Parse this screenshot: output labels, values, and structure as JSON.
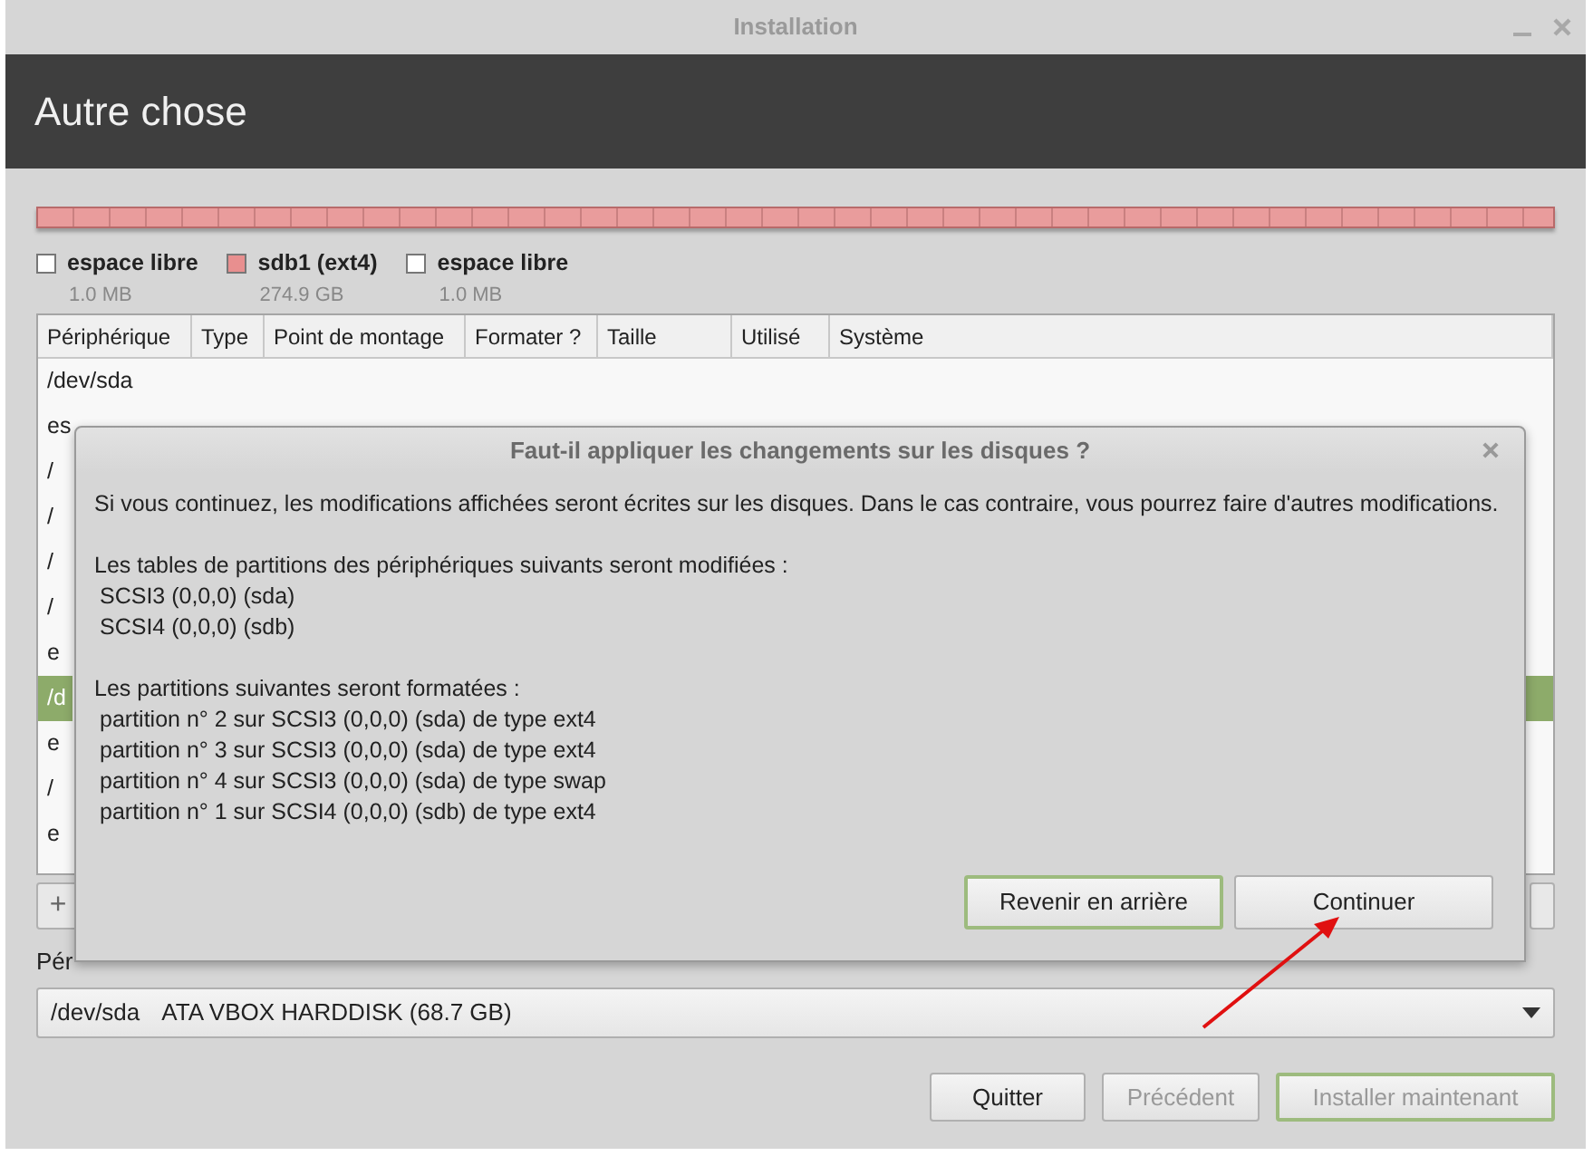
{
  "window": {
    "title": "Installation"
  },
  "header": {
    "title": "Autre chose"
  },
  "legend": [
    {
      "label": "espace libre",
      "size": "1.0 MB",
      "color": "#ffffff"
    },
    {
      "label": "sdb1 (ext4)",
      "size": "274.9 GB",
      "color": "#e88f8f"
    },
    {
      "label": "espace libre",
      "size": "1.0 MB",
      "color": "#ffffff"
    }
  ],
  "table": {
    "columns": [
      "Périphérique",
      "Type",
      "Point de montage",
      "Formater ?",
      "Taille",
      "Utilisé",
      "Système"
    ],
    "rows": [
      {
        "device": "/dev/sda",
        "selected": false
      },
      {
        "device": "es",
        "selected": false
      },
      {
        "device": "/",
        "selected": false
      },
      {
        "device": "/",
        "selected": false
      },
      {
        "device": "/",
        "selected": false
      },
      {
        "device": "/",
        "selected": false
      },
      {
        "device": "e",
        "selected": false
      },
      {
        "device": "/d",
        "selected": true
      },
      {
        "device": "e",
        "selected": false
      },
      {
        "device": "/",
        "selected": false
      },
      {
        "device": "e",
        "selected": false
      }
    ]
  },
  "toolbar": {
    "add_button": "+"
  },
  "boot_device": {
    "label": "Pér",
    "device": "/dev/sda",
    "description": "ATA VBOX HARDDISK (68.7 GB)"
  },
  "buttons": [
    {
      "label": "Quitter",
      "disabled": false,
      "default": false
    },
    {
      "label": "Précédent",
      "disabled": true,
      "default": false
    },
    {
      "label": "Installer maintenant",
      "disabled": true,
      "default": true
    }
  ],
  "dialog": {
    "title": "Faut-il appliquer les changements sur les disques ?",
    "message": "Si vous continuez, les modifications affichées seront écrites sur les disques. Dans le cas contraire, vous pourrez faire d'autres modifications.",
    "sections": [
      {
        "heading": "Les tables de partitions des périphériques suivants seront modifiées :",
        "items": [
          "SCSI3 (0,0,0) (sda)",
          "SCSI4 (0,0,0) (sdb)"
        ]
      },
      {
        "heading": "Les partitions suivantes seront formatées :",
        "items": [
          "partition n° 2 sur SCSI3 (0,0,0) (sda) de type ext4",
          "partition n° 3 sur SCSI3 (0,0,0) (sda) de type ext4",
          "partition n° 4 sur SCSI3 (0,0,0) (sda) de type swap",
          "partition n° 1 sur SCSI4 (0,0,0) (sdb) de type ext4"
        ]
      }
    ],
    "buttons": [
      {
        "label": "Revenir en arrière",
        "default": true
      },
      {
        "label": "Continuer",
        "default": false
      }
    ]
  }
}
